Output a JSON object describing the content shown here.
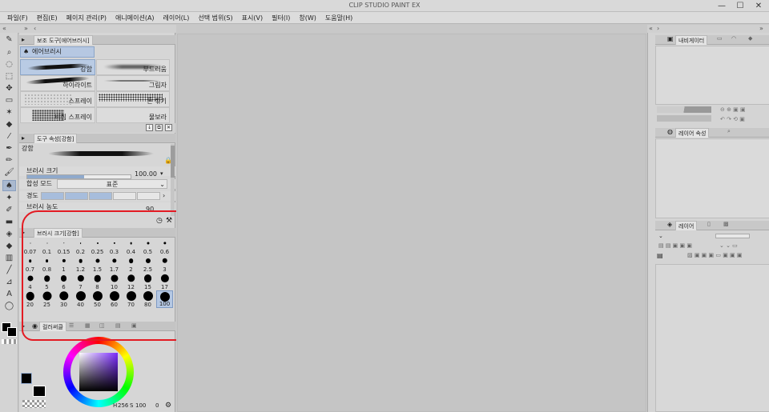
{
  "app": {
    "title": "CLIP STUDIO PAINT EX"
  },
  "window_controls": {
    "minimize": "—",
    "maximize": "☐",
    "close": "✕"
  },
  "menu": [
    "파일(F)",
    "편집(E)",
    "페이지 관리(P)",
    "애니메이션(A)",
    "레이어(L)",
    "선택 범위(S)",
    "표시(V)",
    "필터(I)",
    "창(W)",
    "도움말(H)"
  ],
  "strip": {
    "left_arrows": "«",
    "right_arrows": "»",
    "left_chevron": "‹",
    "right_chevron": "›"
  },
  "sub_tool": {
    "tab_label": "보조 도구[에어브러시]",
    "group_label": "에어브러시",
    "items": [
      {
        "label": "강함",
        "selected": true
      },
      {
        "label": "부드러움",
        "selected": false
      },
      {
        "label": "하이라이트",
        "selected": false
      },
      {
        "label": "그림자",
        "selected": false
      },
      {
        "label": "스프레이",
        "selected": false
      },
      {
        "label": "톤 깎기",
        "selected": false
      },
      {
        "label": "비침 스프레이",
        "selected": false
      },
      {
        "label": "물보라",
        "selected": false
      }
    ]
  },
  "tool_property": {
    "tab_label": "도구 속성[강함]",
    "tool_name": "강함",
    "brush_size_label": "브러시 크기",
    "brush_size_value": "100.00",
    "brush_size_fill": 0.55,
    "blend_mode_label": "합성 모드",
    "blend_mode_value": "표준",
    "hardness_label": "경도",
    "hardness_level": 3,
    "density_label": "브러시 농도",
    "density_value": "90"
  },
  "brush_size_panel": {
    "tab_label": "브러시 크기[강함]",
    "sizes": [
      "0.07",
      "0.1",
      "0.15",
      "0.2",
      "0.25",
      "0.3",
      "0.4",
      "0.5",
      "0.6",
      "0.7",
      "0.8",
      "1",
      "1.2",
      "1.5",
      "1.7",
      "2",
      "2.5",
      "3",
      "4",
      "5",
      "6",
      "7",
      "8",
      "10",
      "12",
      "15",
      "17",
      "20",
      "25",
      "30",
      "40",
      "50",
      "60",
      "70",
      "80",
      "100"
    ],
    "selected": "100"
  },
  "color_panel": {
    "tab_label": "컬러써클",
    "readout_h": "256",
    "readout_s": "100",
    "readout_v": "0",
    "main_color": "#000000",
    "sub_color": "#000000"
  },
  "right_panels": {
    "navigator_tab": "내비게이터",
    "layer_property_tab": "레이어 속성",
    "layer_tab": "레이어"
  },
  "colors": {
    "accent": "#8ca6c8",
    "annotation": "#e31b23"
  }
}
